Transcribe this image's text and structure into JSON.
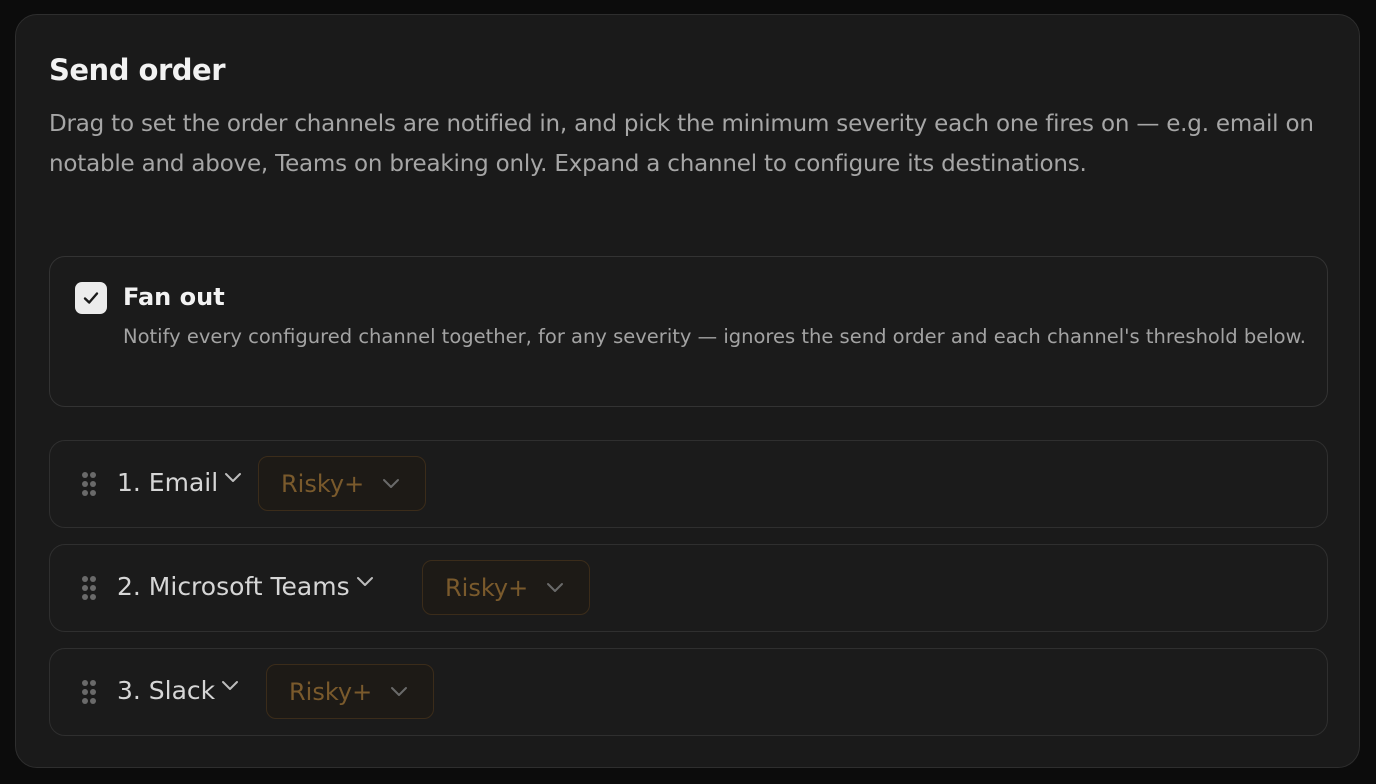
{
  "section": {
    "title": "Send order",
    "description": "Drag to set the order channels are notified in, and pick the minimum severity each one fires on — e.g. email on notable and above, Teams on breaking only. Expand a channel to configure its destinations."
  },
  "fanout": {
    "checked": true,
    "label": "Fan out",
    "help": "Notify every configured channel together, for any severity — ignores the send order and each channel's threshold below."
  },
  "channels": [
    {
      "label": "1. Email",
      "severity": "Risky+"
    },
    {
      "label": "2. Microsoft Teams",
      "severity": "Risky+"
    },
    {
      "label": "3. Slack",
      "severity": "Risky+"
    }
  ],
  "colors": {
    "background": "#0c0c0c",
    "panel": "#1a1a1a",
    "severity_text": "#7a5a2c",
    "severity_border": "#3b2c1a"
  },
  "icons": {
    "checkbox": "check-icon",
    "drag": "drag-handle-icon",
    "expand": "chevron-down-icon"
  }
}
